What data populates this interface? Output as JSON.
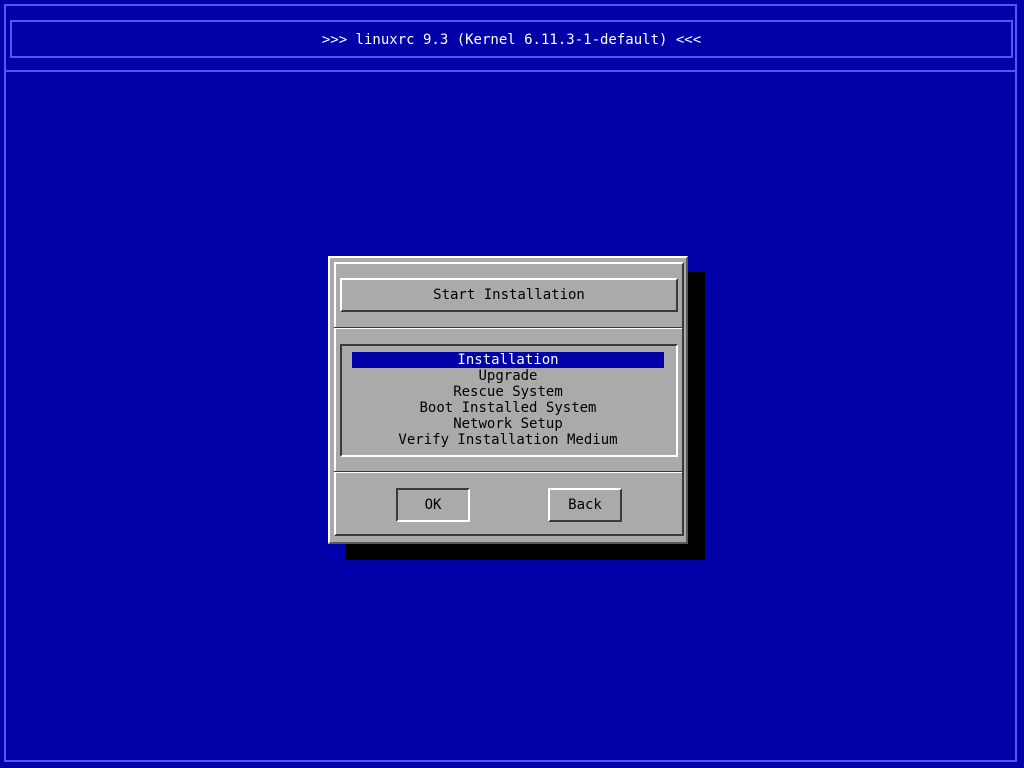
{
  "header": {
    "title": ">>> linuxrc 9.3 (Kernel 6.11.3-1-default) <<<"
  },
  "dialog": {
    "title": "Start Installation",
    "menu": {
      "items": [
        {
          "label": "Installation",
          "selected": true
        },
        {
          "label": "Upgrade",
          "selected": false
        },
        {
          "label": "Rescue System",
          "selected": false
        },
        {
          "label": "Boot Installed System",
          "selected": false
        },
        {
          "label": "Network Setup",
          "selected": false
        },
        {
          "label": "Verify Installation Medium",
          "selected": false
        }
      ]
    },
    "buttons": {
      "ok_label": "OK",
      "back_label": "Back"
    }
  },
  "colors": {
    "background": "#0000a8",
    "frame": "#5454ff",
    "dialog": "#aaaaaa",
    "selection": "#0000a8",
    "text_light": "#ffffff",
    "text_dark": "#000000"
  }
}
